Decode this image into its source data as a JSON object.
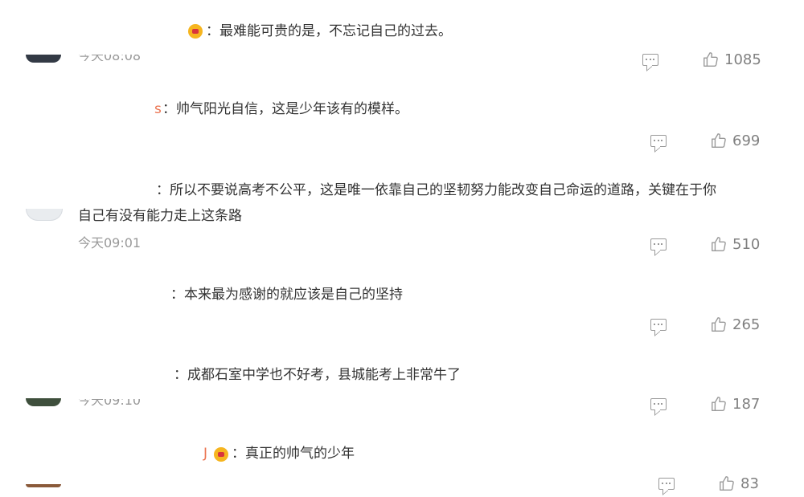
{
  "comments": [
    {
      "name_fragment": "",
      "text_lines": [
        "：最难能可贵的是，不忘记自己的过去。"
      ],
      "timestamp": "今天08:08",
      "likes": "1085"
    },
    {
      "name_fragment": "s",
      "text_lines": [
        "：帅气阳光自信，这是少年该有的模样。"
      ],
      "timestamp": "",
      "likes": "699"
    },
    {
      "name_fragment": "",
      "text_lines": [
        "：所以不要说高考不公平，这是唯一依靠自己的坚韧努力能改变自己命运的道路，关键在于你",
        "自己有没有能力走上这条路"
      ],
      "timestamp": "今天09:01",
      "likes": "510"
    },
    {
      "name_fragment": "",
      "text_lines": [
        "：本来最为感谢的就应该是自己的坚持"
      ],
      "timestamp": "",
      "likes": "265"
    },
    {
      "name_fragment": "",
      "text_lines": [
        "：成都石室中学也不好考，县城能考上非常牛了"
      ],
      "timestamp": "今天09:10",
      "likes": "187"
    },
    {
      "name_fragment": "J",
      "text_lines": [
        "：真正的帅气的少年"
      ],
      "timestamp": "",
      "likes": "83"
    }
  ]
}
